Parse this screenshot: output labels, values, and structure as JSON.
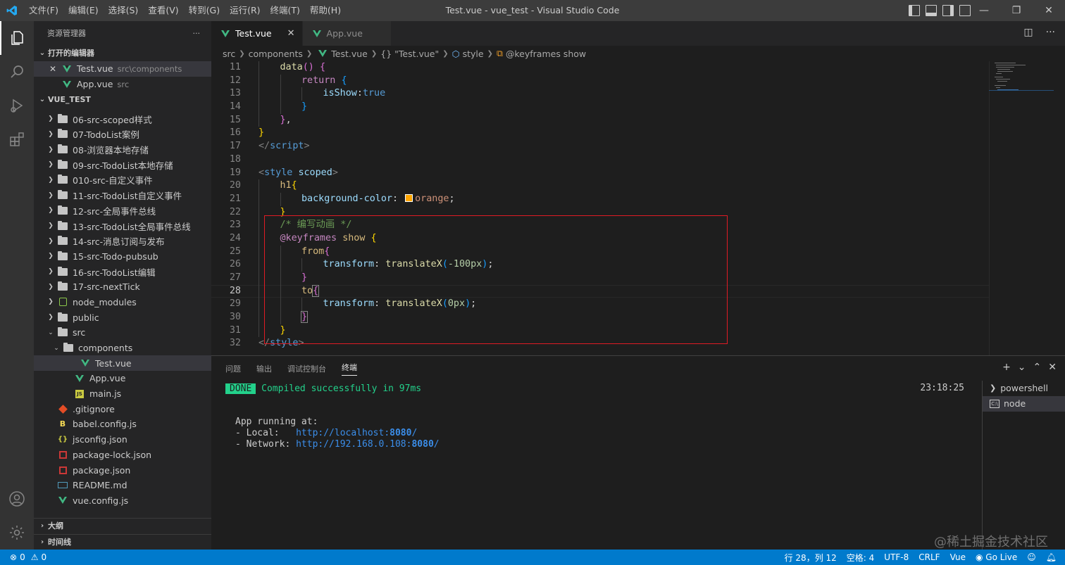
{
  "window": {
    "menu": [
      "文件(F)",
      "编辑(E)",
      "选择(S)",
      "查看(V)",
      "转到(G)",
      "运行(R)",
      "终端(T)",
      "帮助(H)"
    ],
    "title": "Test.vue - vue_test - Visual Studio Code",
    "controls": {
      "minimize": "—",
      "restore": "❐",
      "close": "✕"
    }
  },
  "sidebar": {
    "title": "资源管理器",
    "more": "···",
    "open_editors_header": "打开的编辑器",
    "open_editors": [
      {
        "name": "Test.vue",
        "desc": "src\\components",
        "close": "✕"
      },
      {
        "name": "App.vue",
        "desc": "src"
      }
    ],
    "project_header": "VUE_TEST",
    "tree": [
      {
        "name": "06-src-scoped样式",
        "type": "folder"
      },
      {
        "name": "07-TodoList案例",
        "type": "folder"
      },
      {
        "name": "08-浏览器本地存储",
        "type": "folder"
      },
      {
        "name": "09-src-TodoList本地存储",
        "type": "folder"
      },
      {
        "name": "010-src-自定义事件",
        "type": "folder"
      },
      {
        "name": "11-src-TodoList自定义事件",
        "type": "folder"
      },
      {
        "name": "12-src-全局事件总线",
        "type": "folder"
      },
      {
        "name": "13-src-TodoList全局事件总线",
        "type": "folder"
      },
      {
        "name": "14-src-消息订阅与发布",
        "type": "folder"
      },
      {
        "name": "15-src-Todo-pubsub",
        "type": "folder"
      },
      {
        "name": "16-src-TodoList编辑",
        "type": "folder"
      },
      {
        "name": "17-src-nextTick",
        "type": "folder"
      },
      {
        "name": "node_modules",
        "type": "node"
      },
      {
        "name": "public",
        "type": "folder"
      },
      {
        "name": "src",
        "type": "folder-open"
      },
      {
        "name": "components",
        "type": "folder-open"
      },
      {
        "name": "Test.vue",
        "type": "vue"
      },
      {
        "name": "App.vue",
        "type": "vue"
      },
      {
        "name": "main.js",
        "type": "js"
      },
      {
        "name": ".gitignore",
        "type": "git"
      },
      {
        "name": "babel.config.js",
        "type": "babel"
      },
      {
        "name": "jsconfig.json",
        "type": "json"
      },
      {
        "name": "package-lock.json",
        "type": "npm"
      },
      {
        "name": "package.json",
        "type": "npm"
      },
      {
        "name": "README.md",
        "type": "md"
      },
      {
        "name": "vue.config.js",
        "type": "vue"
      }
    ],
    "outline": "大纲",
    "timeline": "时间线"
  },
  "tabs": [
    {
      "label": "Test.vue",
      "close": "✕"
    },
    {
      "label": "App.vue"
    }
  ],
  "breadcrumb": [
    "src",
    "components",
    "Test.vue",
    "{} \"Test.vue\"",
    "style",
    "@keyframes show"
  ],
  "editor": {
    "lines": [
      "11",
      "12",
      "13",
      "14",
      "15",
      "16",
      "17",
      "18",
      "19",
      "20",
      "21",
      "22",
      "23",
      "24",
      "25",
      "26",
      "27",
      "28",
      "29",
      "30",
      "31",
      "32"
    ],
    "code": {
      "data": "data",
      "return": "return",
      "isShow": "isShow",
      "true": "true",
      "script": "script",
      "style": "style",
      "scoped": "scoped",
      "h1": "h1",
      "bg_prop": "background-color",
      "orange": "orange",
      "comment": "/* 编写动画 */",
      "at_keyframes": "@keyframes",
      "show": "show",
      "from": "from",
      "to": "to",
      "transform": "transform",
      "translateX": "translateX",
      "val_from": "-100px",
      "val_to": "0px"
    }
  },
  "panel": {
    "tabs": [
      "问题",
      "输出",
      "调试控制台",
      "终端"
    ],
    "actions": {
      "add": "+",
      "dropdown": "⌄",
      "maximize": "⌃",
      "close": "✕"
    },
    "terminal": {
      "done": "DONE",
      "compiled": "Compiled successfully in 97ms",
      "time": "23:18:25",
      "running": "App running at:",
      "local_label": "- Local:   ",
      "local_url": "http://localhost:",
      "network_label": "- Network: ",
      "network_url": "http://192.168.0.108:",
      "port": "8080",
      "slash": "/"
    },
    "terminals": [
      "powershell",
      "node"
    ]
  },
  "status": {
    "errors": "0",
    "warnings": "0",
    "position": "行 28，列 12",
    "spaces": "空格: 4",
    "encoding": "UTF-8",
    "eol": "CRLF",
    "language": "Vue",
    "golive": "Go Live"
  },
  "watermark": "@稀土掘金技术社区"
}
